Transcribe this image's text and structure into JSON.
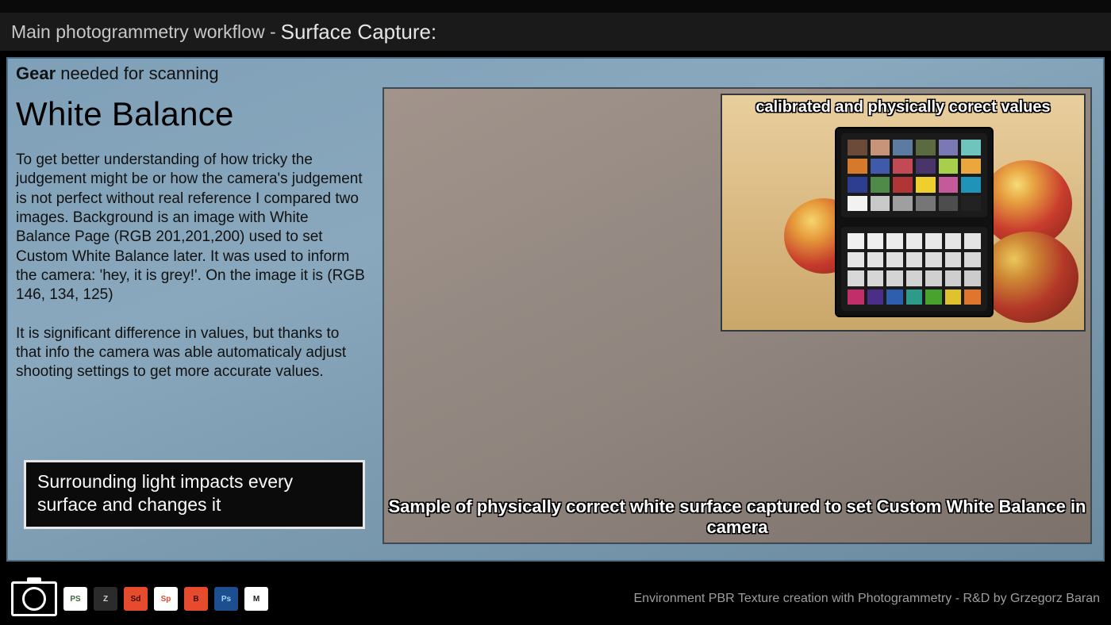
{
  "header": {
    "breadcrumb": "Main photogrammetry workflow - ",
    "section": "Surface Capture:"
  },
  "subheader": {
    "bold": "Gear",
    "rest": " needed for scanning"
  },
  "title": "White Balance",
  "paragraph1": "To get better understanding of how tricky the judgement might be or how the camera's judgement is not perfect without real reference I compared two images. Background is an image with White Balance Page (RGB 201,201,200) used to set Custom White Balance later. It was used to inform the camera: 'hey, it is grey!'. On the image it is (RGB 146, 134, 125)",
  "paragraph2": "It is significant difference in values, but thanks to that info the camera was able automaticaly adjust shooting settings to get more accurate values.",
  "callout": "Surrounding light impacts every surface and changes it",
  "sample_caption": "Sample of physically correct white surface captured to set Custom White Balance in camera",
  "inset_title": "calibrated and physically corect values",
  "checker_top_colors": [
    "#6b4a39",
    "#c79379",
    "#5d7aa0",
    "#5b6a40",
    "#7a79b5",
    "#6fc5bc",
    "#d57a2a",
    "#3f5aa8",
    "#c24a55",
    "#4a356b",
    "#a7cf4c",
    "#e9a73d",
    "#2d3d8f",
    "#4f8a48",
    "#b23535",
    "#efcf2e",
    "#c45a9a",
    "#1f93b8",
    "#f2f2f2",
    "#c9c9c9",
    "#9f9f9f",
    "#767676",
    "#4d4d4d",
    "#222222"
  ],
  "footer": {
    "icons": [
      {
        "name": "photoscan",
        "bg": "#ffffff",
        "fg": "#3a6b3a",
        "label": "PS"
      },
      {
        "name": "zbrush",
        "bg": "#2b2b2b",
        "fg": "#d0d0d0",
        "label": "Z"
      },
      {
        "name": "substance-designer",
        "bg": "#e64b2e",
        "fg": "#3a0d08",
        "label": "Sd"
      },
      {
        "name": "substance-painter",
        "bg": "#ffffff",
        "fg": "#e64b2e",
        "label": "Sp"
      },
      {
        "name": "substance-b3d",
        "bg": "#e64b2e",
        "fg": "#3a0d08",
        "label": "B"
      },
      {
        "name": "photoshop",
        "bg": "#1d4e8f",
        "fg": "#9fd3ff",
        "label": "Ps"
      },
      {
        "name": "marmoset",
        "bg": "#ffffff",
        "fg": "#222222",
        "label": "M"
      }
    ],
    "credit": "Environment PBR Texture creation with Photogrammetry  - R&D by Grzegorz Baran"
  }
}
